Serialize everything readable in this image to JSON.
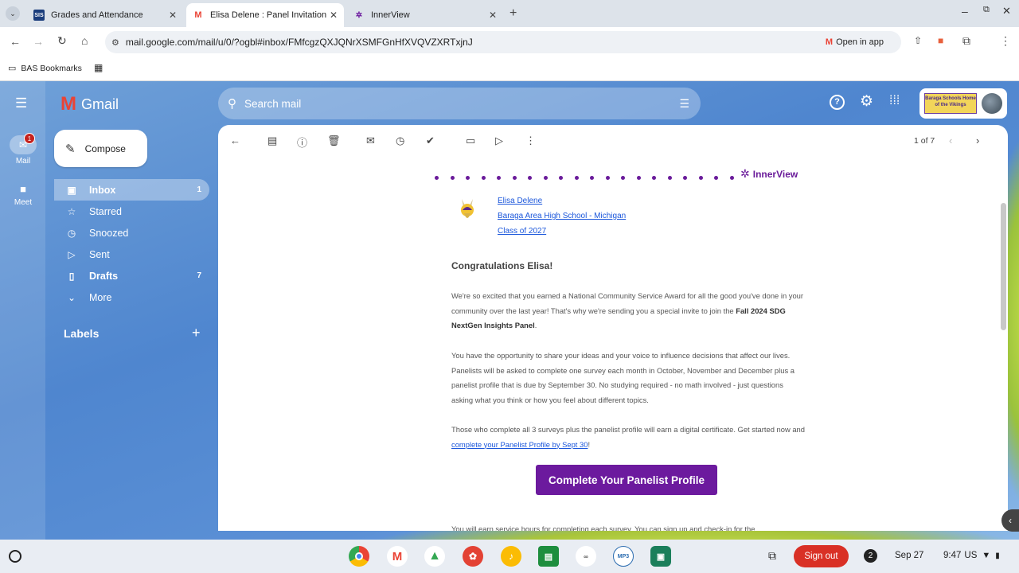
{
  "browser": {
    "tabs": [
      {
        "label": "Grades and Attendance",
        "favicon": "SIS"
      },
      {
        "label": "Elisa Delene : Panel Invitation -",
        "favicon": "M"
      },
      {
        "label": "InnerView"
      }
    ],
    "url": "mail.google.com/mail/u/0/?ogbl#inbox/FMfcgzQXJQNrXSMFGnHfXVQVZXRTxjnJ",
    "open_in_app": "Open in app",
    "bookmarks_label": "BAS Bookmarks"
  },
  "gmail": {
    "brand": "Gmail",
    "search_placeholder": "Search mail",
    "rail": {
      "mail": "Mail",
      "mail_badge": "1",
      "meet": "Meet"
    },
    "compose": "Compose",
    "nav": [
      {
        "label": "Inbox",
        "count": "1",
        "icon": "inbox-icon"
      },
      {
        "label": "Starred",
        "count": "",
        "icon": "star-icon"
      },
      {
        "label": "Snoozed",
        "count": "",
        "icon": "clock-icon"
      },
      {
        "label": "Sent",
        "count": "",
        "icon": "send-icon"
      },
      {
        "label": "Drafts",
        "count": "7",
        "icon": "draft-icon"
      },
      {
        "label": "More",
        "count": "",
        "icon": "chevron-down-icon"
      }
    ],
    "labels_heading": "Labels",
    "pager": "1 of 7",
    "account_logo_text": "Baraga Schools Home of the Vikings"
  },
  "email": {
    "brand": "InnerView",
    "student_name": "Elisa Delene",
    "school": "Baraga Area High School - Michigan",
    "class_year": "Class of 2027",
    "greeting": "Congratulations Elisa!",
    "p1_a": "We're so excited that you earned a National Community Service Award for all the good you've done in your community over the last year! That's why we're sending you a special invite to join the ",
    "p1_bold": "Fall 2024 SDG NextGen Insights Panel",
    "p1_end": ".",
    "p2": "You have the opportunity to share your ideas and your voice to influence decisions that affect our lives. Panelists will be asked to complete one survey each month in October, November and December plus a panelist profile that is due by September 30. No studying required - no math involved - just questions asking what you think or how you feel about different topics.",
    "p3_a": "Those who complete all 3 surveys plus the panelist profile will earn a digital certificate. Get started now and ",
    "p3_link": "complete your Panelist Profile by Sept 30",
    "p3_end": "!",
    "cta": "Complete Your Panelist Profile",
    "p4": "You will earn service hours for completing each survey. You can sign up and check-in for the"
  },
  "shelf": {
    "sign_out": "Sign out",
    "notifications": "2",
    "date": "Sep 27",
    "time": "9:47",
    "locale": "US"
  },
  "colors": {
    "accent_purple": "#6c1a9e",
    "sign_out_red": "#d93025",
    "link_blue": "#1a56db"
  }
}
